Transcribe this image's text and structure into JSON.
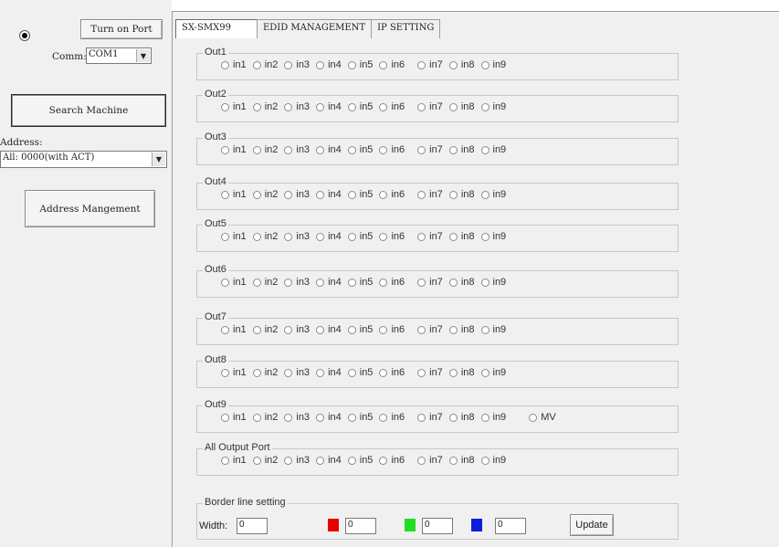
{
  "left": {
    "port_button": "Turn on Port",
    "comm_label": "Comm:",
    "comm_value": "COM1",
    "search_button": "Search Machine",
    "address_label": "Address:",
    "address_value": "All: 0000(with ACT)",
    "address_mgmt_button": "Address Mangement"
  },
  "tabs": [
    "SX-SMX99",
    "EDID MANAGEMENT",
    "IP SETTING"
  ],
  "outputs": [
    {
      "label": "Out1",
      "options": [
        "in1",
        "in2",
        "in3",
        "in4",
        "in5",
        "in6",
        "in7",
        "in8",
        "in9"
      ]
    },
    {
      "label": "Out2",
      "options": [
        "in1",
        "in2",
        "in3",
        "in4",
        "in5",
        "in6",
        "in7",
        "in8",
        "in9"
      ]
    },
    {
      "label": "Out3",
      "options": [
        "in1",
        "in2",
        "in3",
        "in4",
        "in5",
        "in6",
        "in7",
        "in8",
        "in9"
      ]
    },
    {
      "label": "Out4",
      "options": [
        "in1",
        "in2",
        "in3",
        "in4",
        "in5",
        "in6",
        "in7",
        "in8",
        "in9"
      ]
    },
    {
      "label": "Out5",
      "options": [
        "in1",
        "in2",
        "in3",
        "in4",
        "in5",
        "in6",
        "in7",
        "in8",
        "in9"
      ]
    },
    {
      "label": "Out6",
      "options": [
        "in1",
        "in2",
        "in3",
        "in4",
        "in5",
        "in6",
        "in7",
        "in8",
        "in9"
      ]
    },
    {
      "label": "Out7",
      "options": [
        "in1",
        "in2",
        "in3",
        "in4",
        "in5",
        "in6",
        "in7",
        "in8",
        "in9"
      ]
    },
    {
      "label": "Out8",
      "options": [
        "in1",
        "in2",
        "in3",
        "in4",
        "in5",
        "in6",
        "in7",
        "in8",
        "in9"
      ]
    },
    {
      "label": "Out9",
      "options": [
        "in1",
        "in2",
        "in3",
        "in4",
        "in5",
        "in6",
        "in7",
        "in8",
        "in9"
      ],
      "extra": "MV"
    },
    {
      "label": "All Output Port",
      "options": [
        "in1",
        "in2",
        "in3",
        "in4",
        "in5",
        "in6",
        "in7",
        "in8",
        "in9"
      ]
    }
  ],
  "border": {
    "title": "Border line setting",
    "width_label": "Width:",
    "width_value": "0",
    "red_value": "0",
    "green_value": "0",
    "blue_value": "0",
    "red_color": "#e60000",
    "green_color": "#22dd22",
    "blue_color": "#0a1fd8",
    "update_button": "Update"
  }
}
